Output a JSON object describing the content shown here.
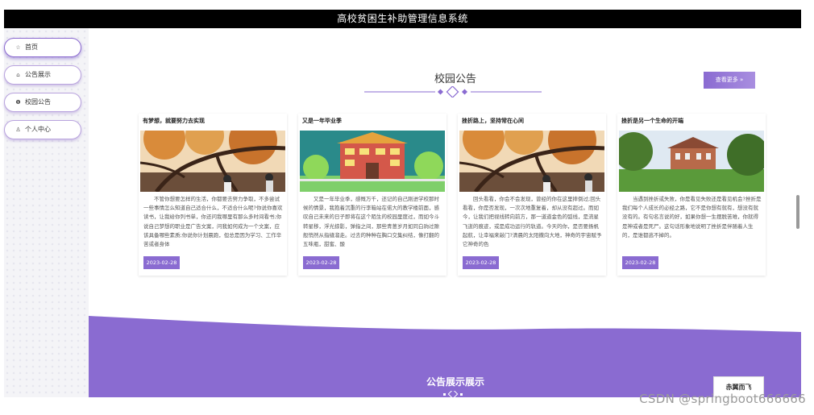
{
  "app": {
    "title": "高校贫困生补助管理信息系统"
  },
  "sidebar": {
    "items": [
      {
        "label": "首页",
        "icon": "star-icon"
      },
      {
        "label": "公告展示",
        "icon": "home-icon"
      },
      {
        "label": "校园公告",
        "icon": "info-icon"
      },
      {
        "label": "个人中心",
        "icon": "person-icon"
      }
    ]
  },
  "section": {
    "title": "校园公告",
    "more_label": "查看更多 »"
  },
  "cards": [
    {
      "title": "有梦想，就要努力去实现",
      "text": "不管你想要怎样的生活，你都要去努力争取，不多尝试一些事情怎么知道自己适合什么，不适合什么呢?你说你喜欢读书，让我给你列书单，你还问我哪里有那么多时间看书;你说自己梦想的职业是广告文案，问我如何成为一个文案，应该具备哪些素质;你说你计划晨跑，但总是因为学习、工作辛苦或者身体",
      "date": "2023-02-28"
    },
    {
      "title": "又是一年毕业季",
      "text": "又是一年毕业季，感慨万千，还记的自己刚进学校那时候的情景，我抱着沉重的行李箱站在偌大的教学楼前面，感叹自己未来的日子即将在这个陌生的校园里度过，而如今斗转星移，浮光掠影，弹指之间，那些青葱岁月如同白驹过隙般悄然从指缝溜走。过去的种种在胸口交集纠结，像打翻的五味瓶，甜蜜、酸",
      "date": "2023-02-28"
    },
    {
      "title": "挫折路上，坚持常在心间",
      "text": "回头看看，你会不会发现，曾经的你在这里摔倒过;回头看看，你是否发现，一次次地重复着，却从没有超过。而如今，让我们把视线转向前方，那一道道金色的弧线，是流星飞逝的痕迹，或是成功运行的轨道。今天的你，是否要扬帆起航，让幸福来敲门?清晨的太阳撒向大地，神奇的宇宙赋予它神奇的色",
      "date": "2023-02-28"
    },
    {
      "title": "挫折是另一个生命的开端",
      "text": "当遇到挫折或失败，你是看见失败还是看见机会?挫折是我们每个人成长的必经之路，它不是你想有就有，想没有就没有的。有句名言说的好，如果你想一生摆脱苦难，你就得是神或者是死尸。这句话形象地说明了挫折是伴随着人生的，是谁都逃不掉的。",
      "date": "2023-02-28"
    }
  ],
  "footer": {
    "title": "公告展示展示",
    "logo_text": "赤翼而飞"
  },
  "watermark": "CSDN @springboot666666",
  "colors": {
    "accent": "#8a6bd1",
    "topbar": "#000000",
    "wave": "#8a6bd1"
  }
}
